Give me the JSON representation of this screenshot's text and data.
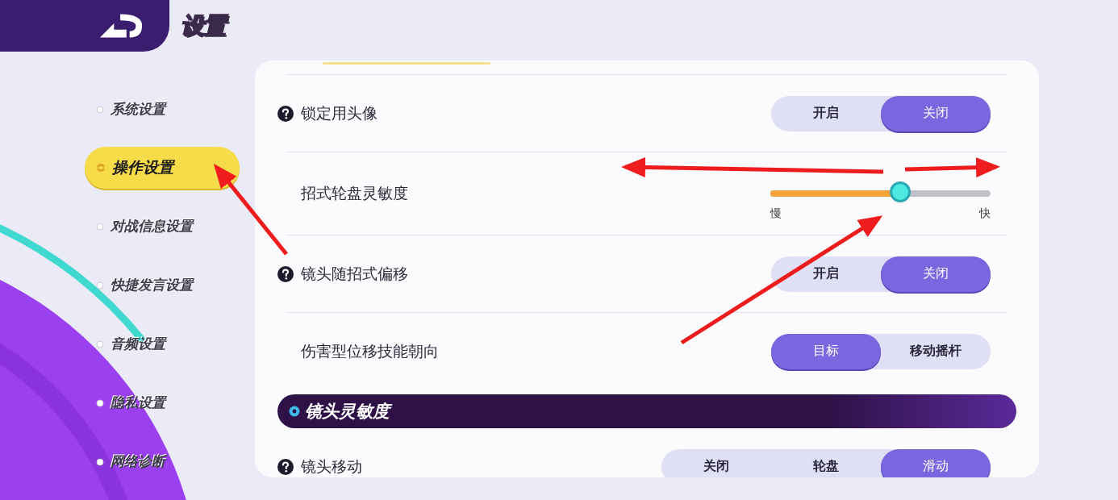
{
  "header": {
    "title": "设置"
  },
  "sidebar": {
    "items": [
      {
        "label": "系统设置",
        "selected": false
      },
      {
        "label": "操作设置",
        "selected": true
      },
      {
        "label": "对战信息设置",
        "selected": false
      },
      {
        "label": "快捷发言设置",
        "selected": false
      },
      {
        "label": "音频设置",
        "selected": false
      },
      {
        "label": "隐私设置",
        "selected": false
      },
      {
        "label": "网络诊断",
        "selected": false
      }
    ]
  },
  "panel": {
    "rows": [
      {
        "kind": "toggle",
        "help": true,
        "label": "锁定用头像",
        "options": [
          {
            "label": "开启",
            "selected": false
          },
          {
            "label": "关闭",
            "selected": true
          }
        ]
      },
      {
        "kind": "slider",
        "help": false,
        "label": "招式轮盘灵敏度",
        "level": 0.59,
        "min_label": "慢",
        "max_label": "快"
      },
      {
        "kind": "toggle",
        "help": true,
        "label": "镜头随招式偏移",
        "options": [
          {
            "label": "开启",
            "selected": false
          },
          {
            "label": "关闭",
            "selected": true
          }
        ]
      },
      {
        "kind": "toggle",
        "help": false,
        "label": "伤害型位移技能朝向",
        "options": [
          {
            "label": "目标",
            "selected": true
          },
          {
            "label": "移动摇杆",
            "selected": false
          }
        ]
      },
      {
        "kind": "section",
        "title": "镜头灵敏度"
      },
      {
        "kind": "toggle",
        "help": true,
        "label": "镜头移动",
        "options": [
          {
            "label": "关闭",
            "selected": false
          },
          {
            "label": "轮盘",
            "selected": false
          },
          {
            "label": "滑动",
            "selected": true
          }
        ]
      }
    ]
  }
}
